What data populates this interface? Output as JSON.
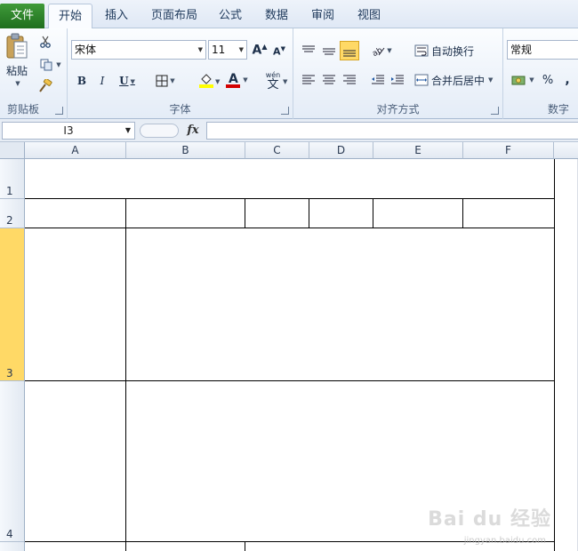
{
  "tabs": {
    "file": "文件",
    "items": [
      "开始",
      "插入",
      "页面布局",
      "公式",
      "数据",
      "审阅",
      "视图"
    ],
    "active_index": 0
  },
  "ribbon": {
    "clipboard": {
      "label": "剪贴板",
      "paste": "粘贴"
    },
    "font": {
      "label": "字体",
      "font_name": "宋体",
      "font_size": "11",
      "phonetic": "wén"
    },
    "alignment": {
      "label": "对齐方式",
      "wrap_text": "自动换行",
      "merge_center": "合并后居中"
    },
    "number": {
      "label": "数字",
      "format": "常规",
      "percent": "%",
      "comma": ","
    }
  },
  "formula_bar": {
    "name_box": "I3",
    "fx": "fx",
    "formula": ""
  },
  "sheet": {
    "columns": [
      "A",
      "B",
      "C",
      "D",
      "E",
      "F"
    ],
    "rows": [
      "1",
      "2",
      "3",
      "4"
    ],
    "selected_row": "3"
  },
  "colors": {
    "file_tab": "#2a7d27",
    "selected_row_header": "#ffd966",
    "font_color_bar": "#d40000",
    "fill_color_bar": "#ffff00"
  },
  "watermark": {
    "brand": "Bai du 经验",
    "url": "jingyan.baidu.com"
  }
}
